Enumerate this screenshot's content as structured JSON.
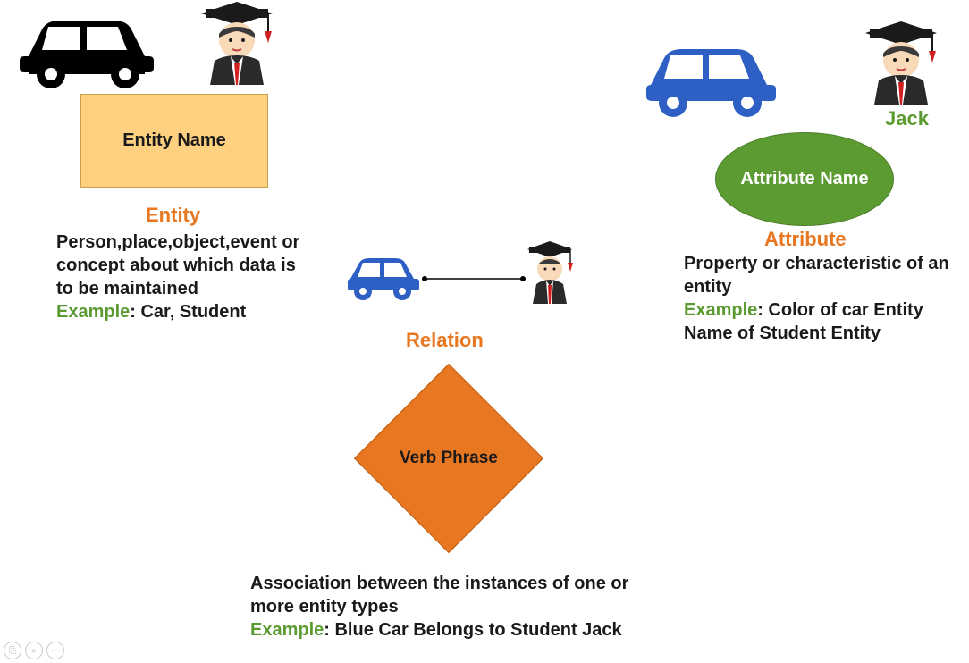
{
  "entity": {
    "box_label": "Entity Name",
    "title": "Entity",
    "desc": "Person,place,object,event or concept about which data is to be maintained",
    "example_prefix": "Example",
    "example_text": ": Car, Student"
  },
  "relation": {
    "title": "Relation",
    "shape_label": "Verb Phrase",
    "desc": "Association between the instances of one or more entity types",
    "example_prefix": "Example",
    "example_text": ": Blue Car Belongs to Student Jack"
  },
  "attribute": {
    "student_name": "Jack",
    "shape_label": "Attribute Name",
    "title": "Attribute",
    "desc": "Property or characteristic of an entity",
    "example_prefix": "Example",
    "example_text": ": Color of car Entity Name of Student Entity"
  },
  "icons": {
    "car_black": "car-icon",
    "car_blue": "car-icon",
    "student": "student-icon"
  }
}
